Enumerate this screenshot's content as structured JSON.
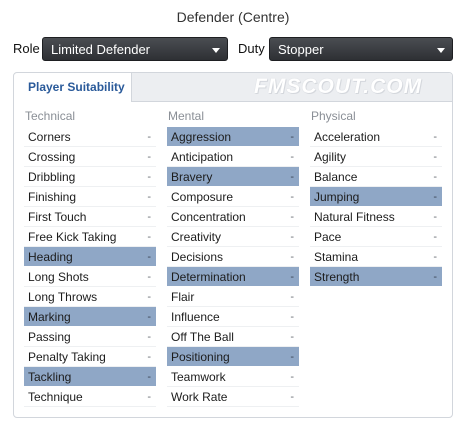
{
  "header": {
    "title": "Defender (Centre)"
  },
  "role": {
    "label": "Role",
    "value": "Limited Defender"
  },
  "duty": {
    "label": "Duty",
    "value": "Stopper"
  },
  "panel": {
    "tab": "Player Suitability",
    "watermark": "FMSCOUT.COM"
  },
  "columns": [
    {
      "heading": "Technical",
      "rows": [
        {
          "label": "Corners",
          "value": "-",
          "highlight": false
        },
        {
          "label": "Crossing",
          "value": "-",
          "highlight": false
        },
        {
          "label": "Dribbling",
          "value": "-",
          "highlight": false
        },
        {
          "label": "Finishing",
          "value": "-",
          "highlight": false
        },
        {
          "label": "First Touch",
          "value": "-",
          "highlight": false
        },
        {
          "label": "Free Kick Taking",
          "value": "-",
          "highlight": false
        },
        {
          "label": "Heading",
          "value": "-",
          "highlight": true
        },
        {
          "label": "Long Shots",
          "value": "-",
          "highlight": false
        },
        {
          "label": "Long Throws",
          "value": "-",
          "highlight": false
        },
        {
          "label": "Marking",
          "value": "-",
          "highlight": true
        },
        {
          "label": "Passing",
          "value": "-",
          "highlight": false
        },
        {
          "label": "Penalty Taking",
          "value": "-",
          "highlight": false
        },
        {
          "label": "Tackling",
          "value": "-",
          "highlight": true
        },
        {
          "label": "Technique",
          "value": "-",
          "highlight": false
        }
      ]
    },
    {
      "heading": "Mental",
      "rows": [
        {
          "label": "Aggression",
          "value": "-",
          "highlight": true
        },
        {
          "label": "Anticipation",
          "value": "-",
          "highlight": false
        },
        {
          "label": "Bravery",
          "value": "-",
          "highlight": true
        },
        {
          "label": "Composure",
          "value": "-",
          "highlight": false
        },
        {
          "label": "Concentration",
          "value": "-",
          "highlight": false
        },
        {
          "label": "Creativity",
          "value": "-",
          "highlight": false
        },
        {
          "label": "Decisions",
          "value": "-",
          "highlight": false
        },
        {
          "label": "Determination",
          "value": "-",
          "highlight": true
        },
        {
          "label": "Flair",
          "value": "-",
          "highlight": false
        },
        {
          "label": "Influence",
          "value": "-",
          "highlight": false
        },
        {
          "label": "Off The Ball",
          "value": "-",
          "highlight": false
        },
        {
          "label": "Positioning",
          "value": "-",
          "highlight": true
        },
        {
          "label": "Teamwork",
          "value": "-",
          "highlight": false
        },
        {
          "label": "Work Rate",
          "value": "-",
          "highlight": false
        }
      ]
    },
    {
      "heading": "Physical",
      "rows": [
        {
          "label": "Acceleration",
          "value": "-",
          "highlight": false
        },
        {
          "label": "Agility",
          "value": "-",
          "highlight": false
        },
        {
          "label": "Balance",
          "value": "-",
          "highlight": false
        },
        {
          "label": "Jumping",
          "value": "-",
          "highlight": true
        },
        {
          "label": "Natural Fitness",
          "value": "-",
          "highlight": false
        },
        {
          "label": "Pace",
          "value": "-",
          "highlight": false
        },
        {
          "label": "Stamina",
          "value": "-",
          "highlight": false
        },
        {
          "label": "Strength",
          "value": "-",
          "highlight": true
        }
      ]
    }
  ]
}
